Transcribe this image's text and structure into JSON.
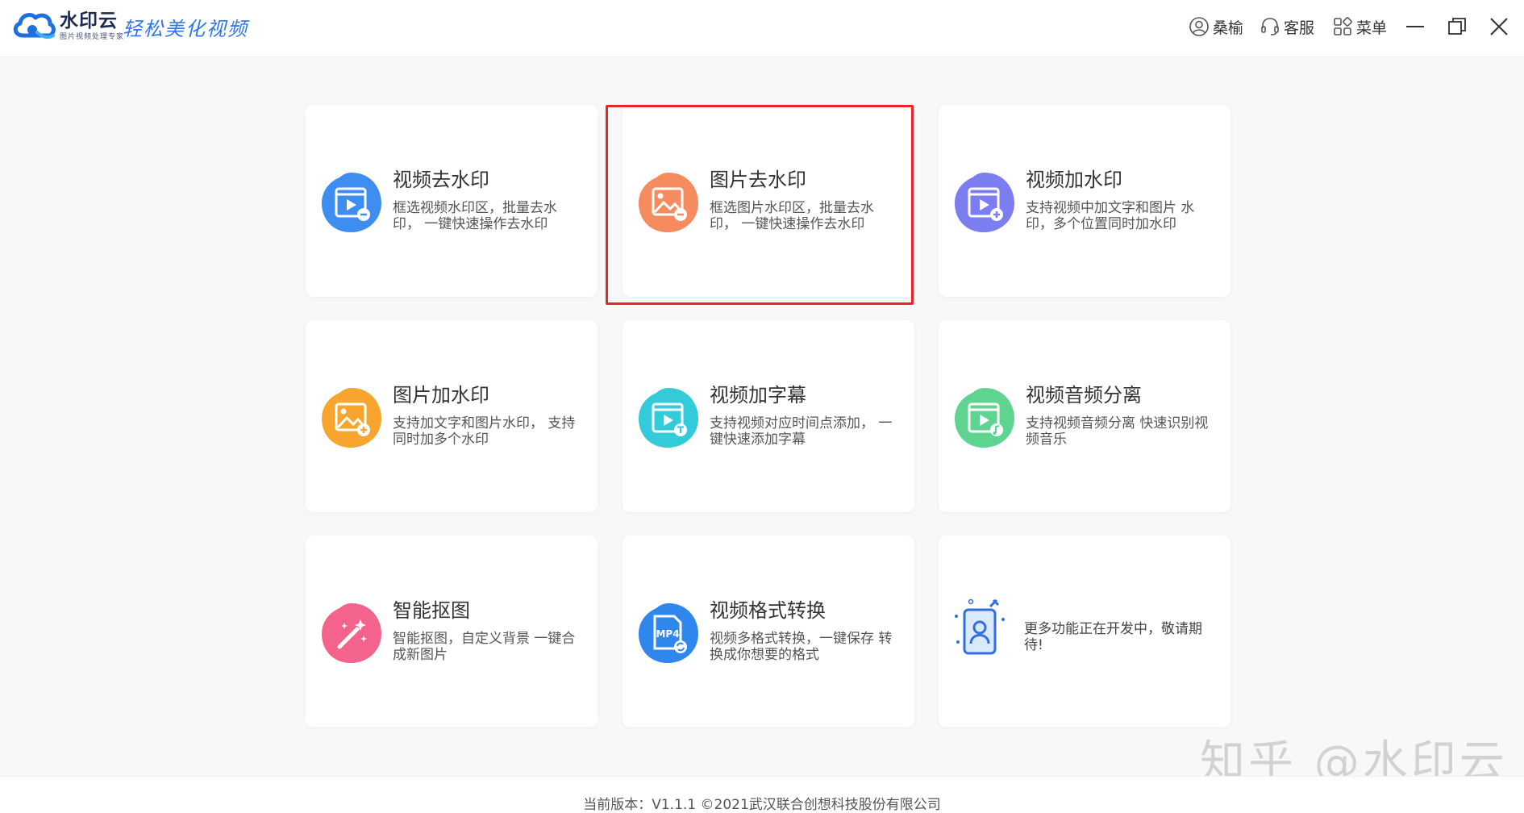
{
  "header": {
    "brand_name": "水印云",
    "brand_sub": "图片视频处理专家",
    "slogan": "轻松美化视频",
    "user_label": "桑榆",
    "service_label": "客服",
    "menu_label": "菜单"
  },
  "cards": [
    {
      "title": "视频去水印",
      "desc": "框选视频水印区，批量去水印，  一键快速操作去水印",
      "icon": "video-remove-watermark-icon",
      "color": "#3d8ef0"
    },
    {
      "title": "图片去水印",
      "desc": "框选图片水印区，批量去水印，  一键快速操作去水印",
      "icon": "image-remove-watermark-icon",
      "color": "#f58b5f"
    },
    {
      "title": "视频加水印",
      "desc": "支持视频中加文字和图片 水印，多个位置同时加水印",
      "icon": "video-add-watermark-icon",
      "color": "#7b7df0"
    },
    {
      "title": "图片加水印",
      "desc": "支持加文字和图片水印，  支持同时加多个水印",
      "icon": "image-add-watermark-icon",
      "color": "#f7a52e"
    },
    {
      "title": "视频加字幕",
      "desc": "支持视频对应时间点添加，  一键快速添加字幕",
      "icon": "video-subtitle-icon",
      "color": "#33cbd9"
    },
    {
      "title": "视频音频分离",
      "desc": "支持视频音频分离 快速识别视频音乐",
      "icon": "audio-separation-icon",
      "color": "#5fd490"
    },
    {
      "title": "智能抠图",
      "desc": "智能抠图，自定义背景 一键合成新图片",
      "icon": "smart-cutout-icon",
      "color": "#f3638c"
    },
    {
      "title": "视频格式转换",
      "desc": "视频多格式转换，一键保存 转换成你想要的格式",
      "icon": "format-convert-icon",
      "color": "#2f86ec",
      "icon_text": "MP4"
    }
  ],
  "dev_card": {
    "desc": "更多功能正在开发中，敬请期待!"
  },
  "highlight_color": "#e5262b",
  "watermark": "知乎 @水印云",
  "footer": {
    "version": "当前版本：V1.1.1 ©2021武汉联合创想科技股份有限公司"
  }
}
